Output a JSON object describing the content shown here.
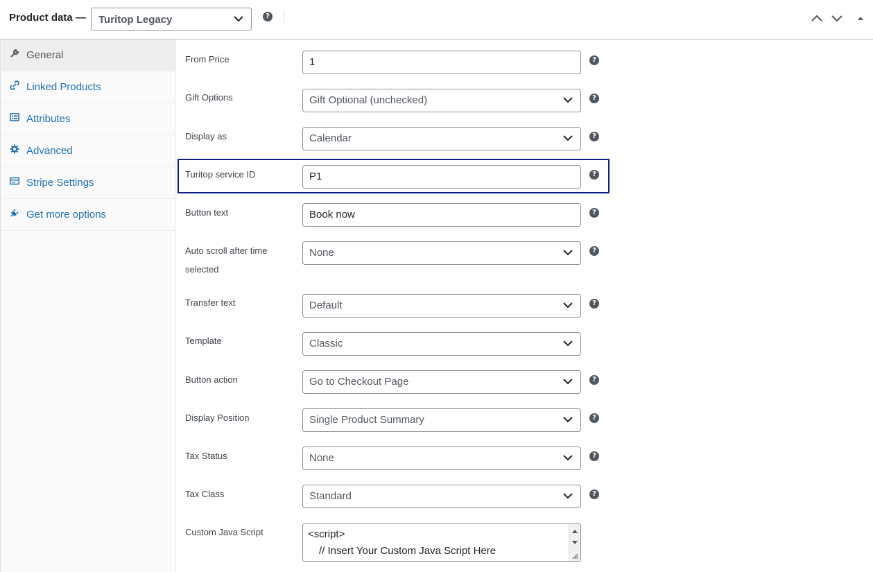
{
  "header": {
    "title": "Product data —",
    "product_type": "Turitop Legacy",
    "help_glyph": "?"
  },
  "sidebar": {
    "tabs": [
      {
        "label": "General",
        "icon": "wrench-icon",
        "active": true
      },
      {
        "label": "Linked Products",
        "icon": "link-icon",
        "active": false
      },
      {
        "label": "Attributes",
        "icon": "list-view-icon",
        "active": false
      },
      {
        "label": "Advanced",
        "icon": "gear-icon",
        "active": false
      },
      {
        "label": "Stripe Settings",
        "icon": "card-icon",
        "active": false
      },
      {
        "label": "Get more options",
        "icon": "plugin-icon",
        "active": false
      }
    ]
  },
  "fields": [
    {
      "label": "From Price",
      "value": "1",
      "type": "text",
      "help": true
    },
    {
      "label": "Gift Options",
      "value": "Gift Optional (unchecked)",
      "type": "select",
      "help": true
    },
    {
      "label": "Display as",
      "value": "Calendar",
      "type": "select",
      "help": true
    },
    {
      "label": "Turitop service ID",
      "value": "P1",
      "type": "text",
      "help": true,
      "highlighted": true
    },
    {
      "label": "Button text",
      "value": "Book now",
      "type": "text",
      "help": true
    },
    {
      "label": "Auto scroll after time selected",
      "value": "None",
      "type": "select",
      "help": true
    },
    {
      "label": "Transfer text",
      "value": "Default",
      "type": "select",
      "help": true
    },
    {
      "label": "Template",
      "value": "Classic",
      "type": "select",
      "help": false
    },
    {
      "label": "Button action",
      "value": "Go to Checkout Page",
      "type": "select",
      "help": true
    },
    {
      "label": "Display Position",
      "value": "Single Product Summary",
      "type": "select",
      "help": true
    },
    {
      "label": "Tax Status",
      "value": "None",
      "type": "select",
      "help": true
    },
    {
      "label": "Tax Class",
      "value": "Standard",
      "type": "select",
      "help": true
    }
  ],
  "custom_js": {
    "label": "Custom Java Script",
    "line1": "<script>",
    "line2": "// Insert Your Custom Java Script Here"
  },
  "colors": {
    "accent": "#2271b1",
    "highlight_border": "#0b1f8c"
  }
}
